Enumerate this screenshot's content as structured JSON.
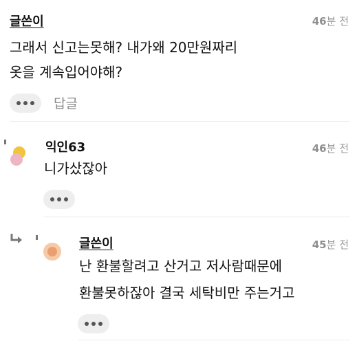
{
  "comments": [
    {
      "author": "글쓴이",
      "time_value": "46",
      "time_unit": "분 전",
      "lines": [
        "그래서 신고는못해? 내가왜 20만원짜리",
        "옷을 계속입어야해?"
      ],
      "more_icon": "more-dots-icon",
      "reply_label": "답글"
    },
    {
      "author": "익인63",
      "time_value": "46",
      "time_unit": "분 전",
      "lines": [
        "니가샀잖아"
      ],
      "avatar_colors": [
        "#f2c43a",
        "#eeb6c2"
      ],
      "more_icon": "more-dots-icon"
    },
    {
      "author": "글쓴이",
      "time_value": "45",
      "time_unit": "분 전",
      "lines": [
        "난 환불할려고 산거고 저사람때문에",
        "환불못하잖아 결국 세탁비만 주는거고"
      ],
      "avatar_colors": [
        "#f6c9a7",
        "#e9a070"
      ],
      "reply_icon": "reply-arrow-icon",
      "more_icon": "more-dots-icon"
    }
  ]
}
